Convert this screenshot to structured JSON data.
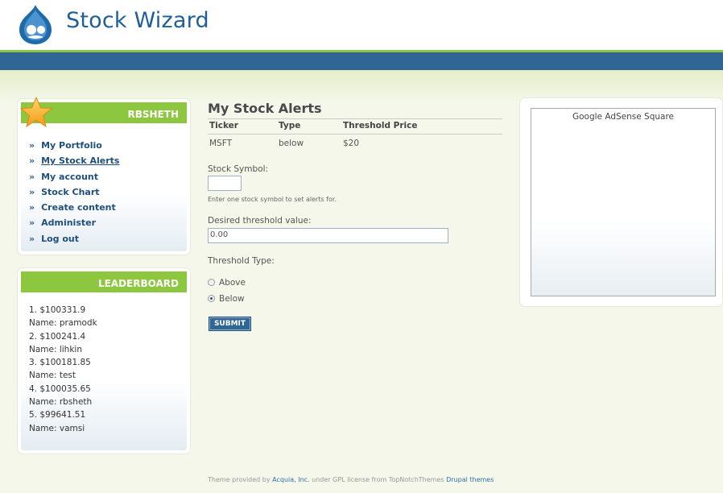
{
  "site": {
    "name": "Stock Wizard"
  },
  "user_block": {
    "title": "RBSHETH",
    "items": [
      {
        "label": "My Portfolio",
        "active": false
      },
      {
        "label": "My Stock Alerts",
        "active": true
      },
      {
        "label": "My account",
        "active": false
      },
      {
        "label": "Stock Chart",
        "active": false
      },
      {
        "label": "Create content",
        "active": false
      },
      {
        "label": "Administer",
        "active": false
      },
      {
        "label": "Log out",
        "active": false
      }
    ],
    "bullet": "»"
  },
  "leaderboard": {
    "title": "LEADERBOARD",
    "lines": [
      "1. $100331.9",
      "Name: pramodk",
      "2. $100241.4",
      "Name: lihkin",
      "3. $100181.85",
      "Name: test",
      "4. $100035.65",
      "Name: rbsheth",
      "5. $99641.51",
      "Name: vamsi"
    ]
  },
  "alerts": {
    "title": "My Stock Alerts",
    "columns": [
      "Ticker",
      "Type",
      "Threshold Price"
    ],
    "rows": [
      [
        "MSFT",
        "below",
        "$20"
      ]
    ]
  },
  "form": {
    "symbol_label": "Stock Symbol:",
    "symbol_value": "",
    "symbol_help": "Enter one stock symbol to set alerts for.",
    "threshold_label": "Desired threshold value:",
    "threshold_value": "0.00",
    "type_label": "Threshold Type:",
    "options": [
      {
        "label": "Above",
        "checked": false
      },
      {
        "label": "Below",
        "checked": true
      }
    ],
    "submit_label": "SUBMIT"
  },
  "ad": {
    "label": "Google AdSense Square"
  },
  "footer": {
    "text1": "Theme provided by ",
    "link1": "Acquia, Inc.",
    "text2": " under GPL license from TopNotchThemes ",
    "link2": "Drupal themes"
  },
  "colors": {
    "green": "#8dc63f",
    "blue": "#2f6694",
    "link": "#1e4f7e"
  }
}
